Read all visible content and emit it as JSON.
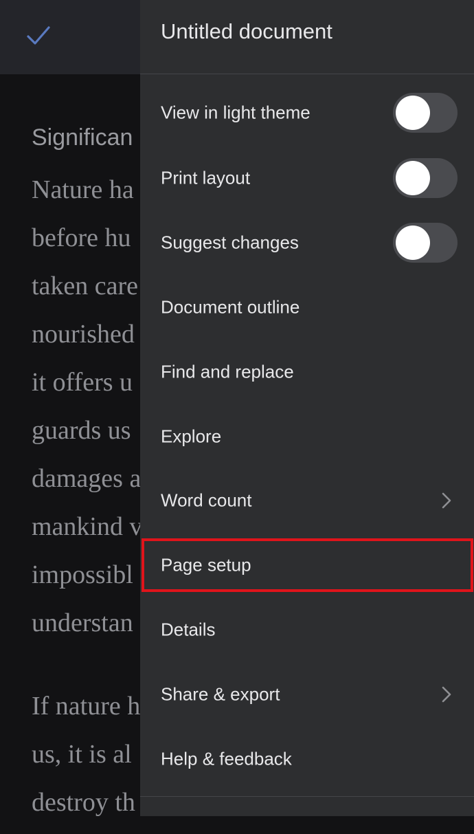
{
  "document": {
    "done_icon": "check-icon",
    "heading": "Significan",
    "lines": [
      "Nature ha",
      "before hu",
      "taken care",
      "nourished",
      "it offers u",
      "guards us",
      "damages a",
      "mankind v",
      "impossibl",
      "understan"
    ],
    "lines_after_gap": [
      "If nature h",
      "us, it is al",
      "destroy th"
    ]
  },
  "menu": {
    "title": "Untitled document",
    "items": [
      {
        "label": "View in light theme",
        "control": "toggle",
        "on": false
      },
      {
        "label": "Print layout",
        "control": "toggle",
        "on": false
      },
      {
        "label": "Suggest changes",
        "control": "toggle",
        "on": false
      },
      {
        "label": "Document outline"
      },
      {
        "label": "Find and replace"
      },
      {
        "label": "Explore"
      },
      {
        "label": "Word count",
        "control": "chevron-right-icon"
      },
      {
        "label": "Page setup",
        "highlighted": true
      },
      {
        "label": "Details"
      },
      {
        "label": "Share & export",
        "control": "chevron-right-icon"
      },
      {
        "label": "Help & feedback"
      }
    ]
  },
  "colors": {
    "menu_background": "#2d2e30",
    "document_background": "#121214",
    "highlight_border": "#e0141b",
    "toggle_track": "#4a4b4f",
    "accent_check": "#5a7ac0"
  }
}
